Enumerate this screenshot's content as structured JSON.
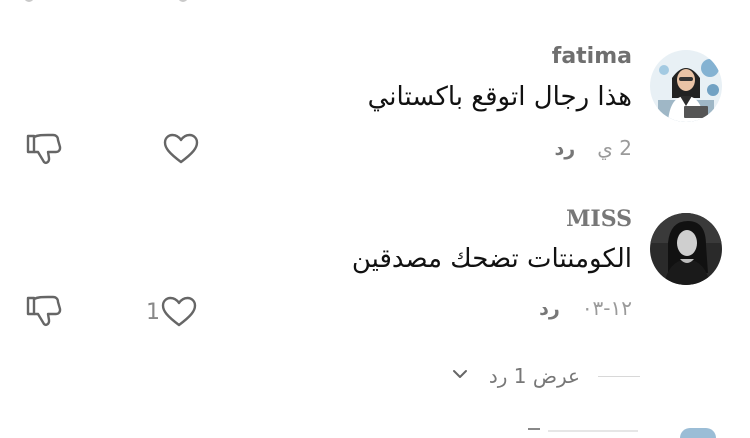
{
  "comments": [
    {
      "username": "fatima",
      "text": "هذا رجال اتوقع باكستاني",
      "time": "2 ي",
      "reply_label": "رد",
      "like_count": ""
    },
    {
      "username": "MISS",
      "text": "الكومنتات تضحك مصدقين",
      "time": "١٢-٠٣",
      "reply_label": "رد",
      "like_count": "1"
    }
  ],
  "view_replies": {
    "label": "عرض 1 رد"
  },
  "colors": {
    "text": "#111111",
    "muted": "#777777",
    "icon": "#666666"
  }
}
